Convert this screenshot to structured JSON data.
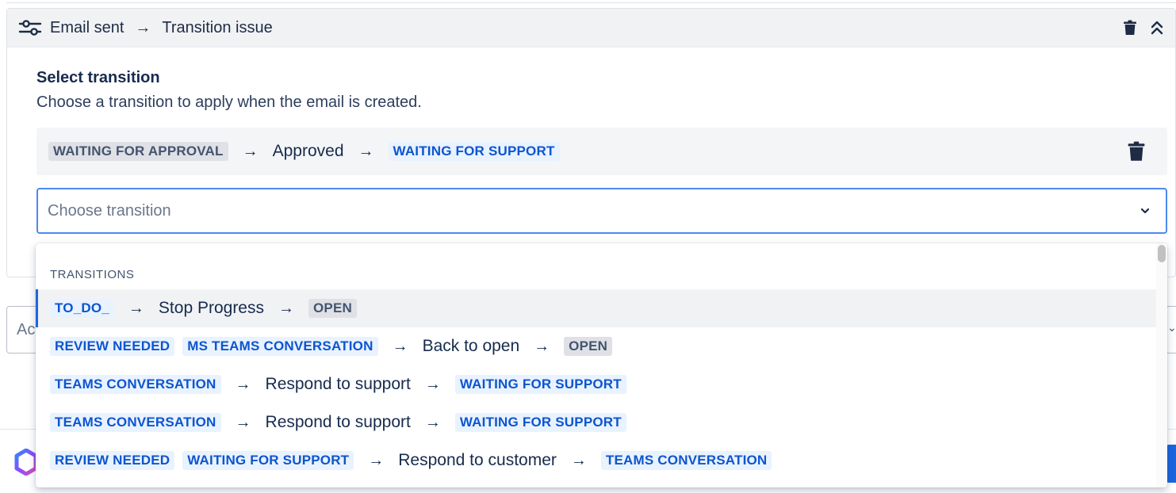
{
  "panel": {
    "header": {
      "trigger": "Email sent",
      "action": "Transition issue",
      "arrow": "→"
    },
    "section_title": "Select transition",
    "section_description": "Choose a transition to apply when the email is created.",
    "selected_transition": {
      "from": "WAITING FOR APPROVAL",
      "name": "Approved",
      "to": "WAITING FOR SUPPORT"
    },
    "select": {
      "placeholder": "Choose transition"
    }
  },
  "behind": {
    "input_text": "Ac"
  },
  "menu": {
    "group_label": "TRANSITIONS",
    "items": [
      {
        "from": [
          {
            "label": "TO_DO_",
            "color": "blue"
          }
        ],
        "name": "Stop Progress",
        "to": {
          "label": "OPEN",
          "color": "grey"
        },
        "active": true
      },
      {
        "from": [
          {
            "label": "REVIEW NEEDED",
            "color": "blue"
          },
          {
            "label": "MS TEAMS CONVERSATION",
            "color": "blue"
          }
        ],
        "name": "Back to open",
        "to": {
          "label": "OPEN",
          "color": "grey"
        },
        "active": false
      },
      {
        "from": [
          {
            "label": "TEAMS CONVERSATION",
            "color": "blue"
          }
        ],
        "name": "Respond to support",
        "to": {
          "label": "WAITING FOR SUPPORT",
          "color": "blue"
        },
        "active": false
      },
      {
        "from": [
          {
            "label": "TEAMS CONVERSATION",
            "color": "blue"
          }
        ],
        "name": "Respond to support",
        "to": {
          "label": "WAITING FOR SUPPORT",
          "color": "blue"
        },
        "active": false
      },
      {
        "from": [
          {
            "label": "REVIEW NEEDED",
            "color": "blue"
          },
          {
            "label": "WAITING FOR SUPPORT",
            "color": "blue"
          }
        ],
        "name": "Respond to customer",
        "to": {
          "label": "TEAMS CONVERSATION",
          "color": "blue"
        },
        "active": false
      }
    ]
  },
  "icons": {
    "header": "sliders-icon",
    "delete": "trash-icon",
    "collapse": "chevrons-up-icon",
    "dropdown": "chevron-down-icon",
    "footer_logo": "hexagon-logo-icon"
  },
  "colors": {
    "accent": "#1d66e0",
    "focus_border": "#4c8af0",
    "lozenge_blue_bg": "#e9f2ff",
    "lozenge_blue_text": "#0c55cf",
    "lozenge_grey_bg": "#dfe1e6",
    "lozenge_grey_text": "#44546f"
  }
}
